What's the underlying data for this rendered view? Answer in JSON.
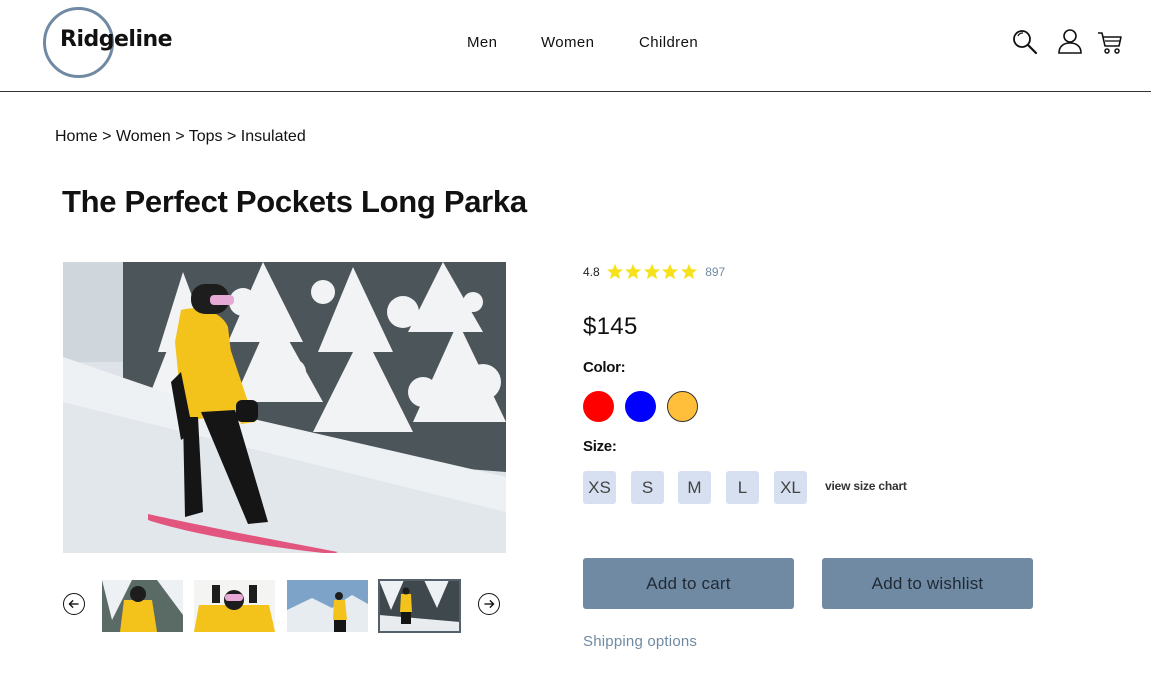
{
  "brand": {
    "name": "Ridgeline",
    "ring_color": "#6f8aa2"
  },
  "nav": {
    "items": [
      {
        "label": "Men"
      },
      {
        "label": "Women"
      },
      {
        "label": "Children"
      }
    ]
  },
  "header_icons": [
    "search-icon",
    "account-icon",
    "cart-icon"
  ],
  "breadcrumb": {
    "items": [
      "Home",
      "Women",
      "Tops",
      "Insulated"
    ],
    "separator": ">"
  },
  "product": {
    "title": "The Perfect Pockets Long Parka",
    "rating": {
      "value": "4.8",
      "stars": 5,
      "review_count": "897",
      "star_color": "#f6e21c"
    },
    "price": "$145",
    "color_label": "Color:",
    "colors": [
      {
        "name": "red",
        "hex": "#ff0000"
      },
      {
        "name": "blue",
        "hex": "#0000ff"
      },
      {
        "name": "yellow",
        "hex": "#ffbf3a",
        "selected": true
      }
    ],
    "size_label": "Size:",
    "sizes": [
      "XS",
      "S",
      "M",
      "L",
      "XL"
    ],
    "size_chart_label": "view size chart",
    "add_to_cart_label": "Add to cart",
    "add_to_wishlist_label": "Add to wishlist",
    "shipping_label": "Shipping options"
  },
  "gallery": {
    "main_image": "snowboarder-in-yellow-parka",
    "thumbnails": [
      {
        "name": "thumb-parka-snow-trees"
      },
      {
        "name": "thumb-parka-goggles"
      },
      {
        "name": "thumb-parka-mountain-view"
      },
      {
        "name": "thumb-parka-snowboard",
        "selected": true
      }
    ]
  },
  "colors": {
    "accent": "#6f8aa2",
    "size_bg": "#d6e0f0",
    "text": "#111111"
  }
}
